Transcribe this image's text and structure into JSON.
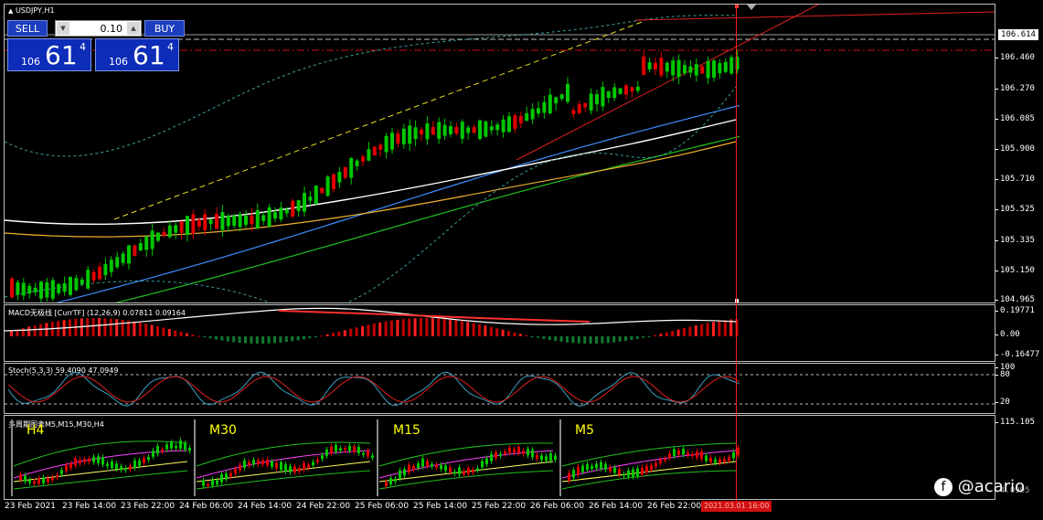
{
  "window": {
    "symbol_title": "USDJPY,H1"
  },
  "trade_panel": {
    "sell_label": "SELL",
    "buy_label": "BUY",
    "lot_value": "0.10",
    "sell_quote": {
      "small": "106",
      "big": "61",
      "pip": "4"
    },
    "buy_quote": {
      "small": "106",
      "big": "61",
      "pip": "4"
    }
  },
  "price_axis": {
    "ticks": [
      "106.614",
      "106.460",
      "106.270",
      "106.085",
      "105.900",
      "105.710",
      "105.525",
      "105.335",
      "105.150",
      "104.965"
    ],
    "current_price": "106.614"
  },
  "macd": {
    "label": "MACD无极线 [CurrTF] (12,26,9) 0.07811 0.09164",
    "ticks": [
      "0.19771",
      "0.00",
      "-0.16477"
    ]
  },
  "stoch": {
    "label": "Stoch(5,3,3) 59.4090 47.0949",
    "ticks": [
      "100",
      "80",
      "20"
    ]
  },
  "mtf": {
    "label": "多周期图表M5,M15,M30,H4",
    "tf_labels": [
      "H4",
      "M30",
      "M15",
      "M5"
    ],
    "ticks": [
      "115.105",
      "4.0995"
    ]
  },
  "time_axis": {
    "labels": [
      "23 Feb 2021",
      "23 Feb 14:00",
      "23 Feb 22:00",
      "24 Feb 06:00",
      "24 Feb 14:00",
      "24 Feb 22:00",
      "25 Feb 06:00",
      "25 Feb 14:00",
      "25 Feb 22:00",
      "26 Feb 06:00",
      "26 Feb 14:00",
      "26 Feb 22:00"
    ],
    "cursor_time": "2021.03.01 16:00"
  },
  "watermark": {
    "text": "@acario"
  },
  "colors": {
    "bull": "#00c800",
    "bear": "#e00000",
    "panel_blue": "#0d2cb8",
    "cursor_red": "#ff2020",
    "ma_white": "#ffffff",
    "ma_orange": "#f0b030",
    "ma_green": "#20c020",
    "ma_blue": "#3c8cff"
  }
}
